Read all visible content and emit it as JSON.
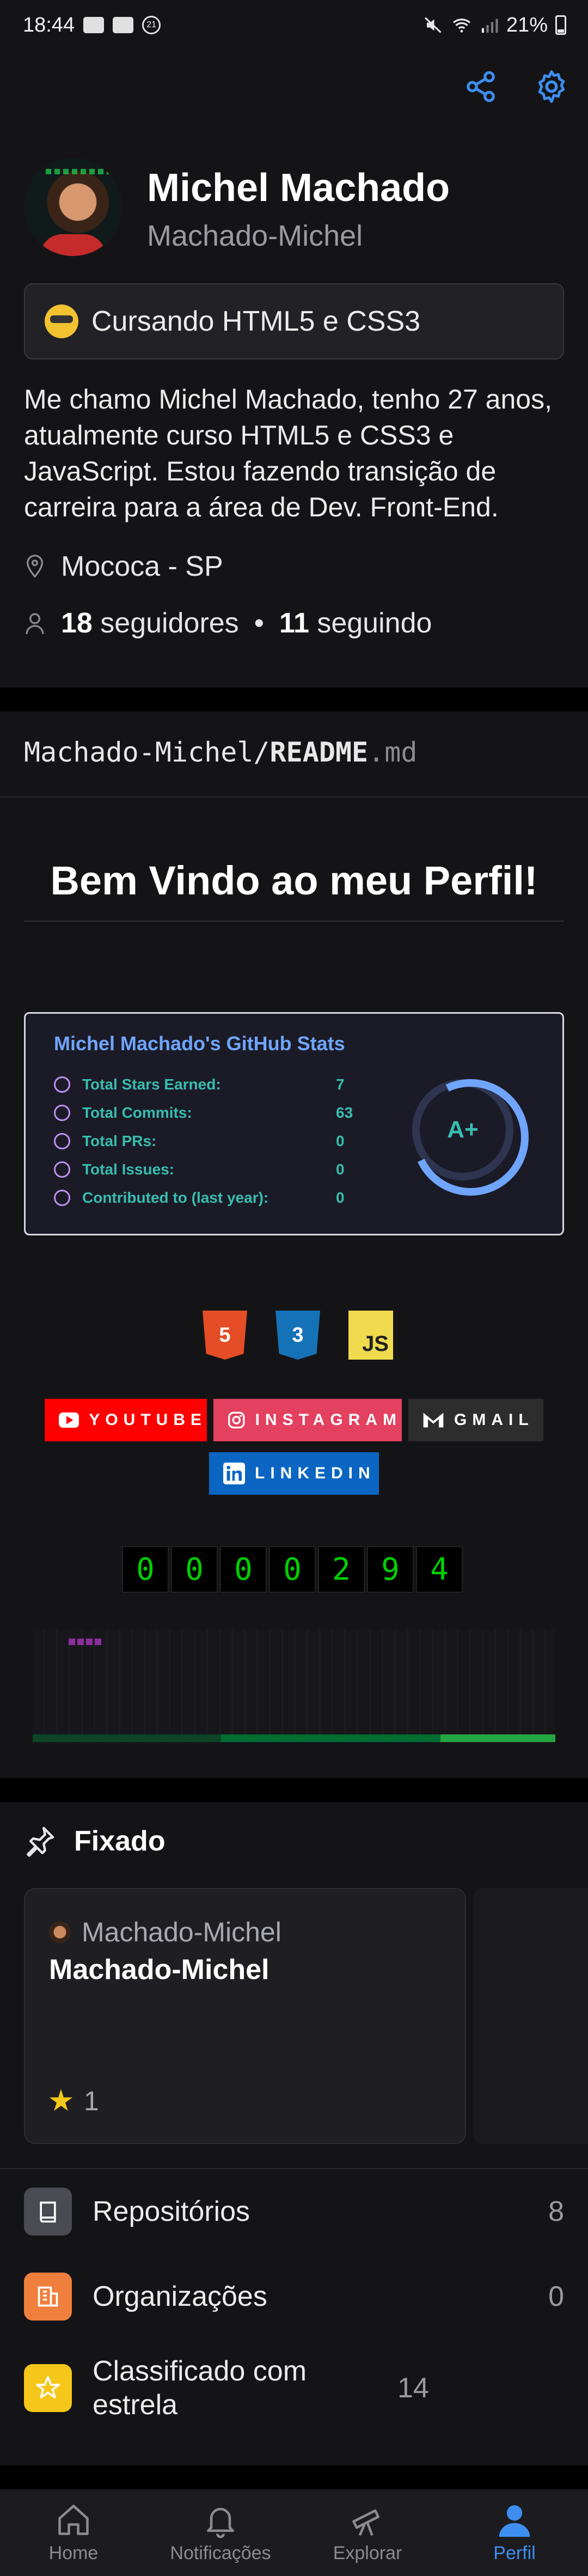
{
  "status_bar": {
    "time": "18:44",
    "notif_count": "21",
    "battery": "21%"
  },
  "profile": {
    "name": "Michel Machado",
    "login": "Machado-Michel",
    "status": "Cursando HTML5 e CSS3",
    "bio": "Me chamo Michel Machado, tenho 27 anos, atualmente curso HTML5 e CSS3 e JavaScript. Estou fazendo transição de carreira para a área de Dev. Front-End.",
    "location": "Mococa - SP",
    "followers_count": "18",
    "followers_label": "seguidores",
    "following_count": "11",
    "following_label": "seguindo"
  },
  "readme": {
    "path": "Machado-Michel/",
    "file": "README",
    "ext": ".md",
    "welcome": "Bem Vindo ao meu Perfil!",
    "stats": {
      "title": "Michel Machado's GitHub Stats",
      "rows": [
        {
          "label": "Total Stars Earned:",
          "value": "7"
        },
        {
          "label": "Total Commits:",
          "value": "63"
        },
        {
          "label": "Total PRs:",
          "value": "0"
        },
        {
          "label": "Total Issues:",
          "value": "0"
        },
        {
          "label": "Contributed to (last year):",
          "value": "0"
        }
      ],
      "grade": "A+",
      "progress_fraction": 0.85
    },
    "techs": [
      {
        "name": "HTML5",
        "short": "5"
      },
      {
        "name": "CSS3",
        "short": "3"
      },
      {
        "name": "JavaScript",
        "short": "JS"
      }
    ],
    "badges": {
      "youtube": "YOUTUBE",
      "instagram": "INSTAGRAM",
      "gmail": "GMAIL",
      "linkedin": "LINKEDIN"
    },
    "counter_digits": [
      "0",
      "0",
      "0",
      "0",
      "2",
      "9",
      "4"
    ],
    "contribution_bar_segments": [
      {
        "fraction": 0.36,
        "color": "#0e4429"
      },
      {
        "fraction": 0.42,
        "color": "#006d32"
      },
      {
        "fraction": 0.22,
        "color": "#26a641"
      }
    ]
  },
  "pinned": {
    "title": "Fixado",
    "card": {
      "owner": "Machado-Michel",
      "repo": "Machado-Michel",
      "stars": "1"
    }
  },
  "lists": [
    {
      "label": "Repositórios",
      "count": "8",
      "color": "#4a4a52",
      "icon": "repo-icon"
    },
    {
      "label": "Organizações",
      "count": "0",
      "color": "#f07e3c",
      "icon": "organization-icon"
    },
    {
      "label": "Classificado com estrela",
      "count": "14",
      "color": "#f5c71a",
      "icon": "star-icon"
    }
  ],
  "nav": [
    {
      "label": "Home",
      "icon": "home-icon"
    },
    {
      "label": "Notificações",
      "icon": "bell-icon"
    },
    {
      "label": "Explorar",
      "icon": "telescope-icon"
    },
    {
      "label": "Perfil",
      "icon": "person-icon",
      "active": true
    }
  ],
  "colors": {
    "accent": "#3d8ef0",
    "background": "#141416",
    "stats_title": "#70a5fd",
    "stats_text": "#38bdae"
  }
}
